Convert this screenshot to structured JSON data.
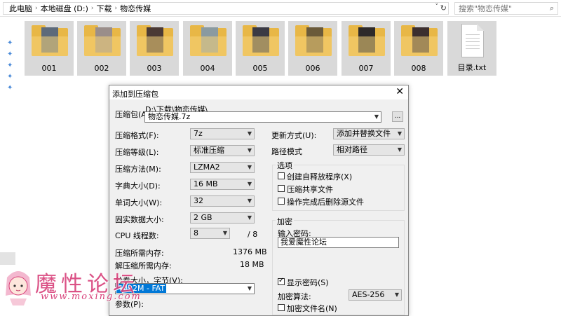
{
  "explorer": {
    "breadcrumbs": [
      "此电脑",
      "本地磁盘 (D:)",
      "下载",
      "物恋传媒"
    ],
    "search_placeholder": "搜索\"物恋传媒\"",
    "files": [
      {
        "label": "001",
        "type": "folder"
      },
      {
        "label": "002",
        "type": "folder"
      },
      {
        "label": "003",
        "type": "folder"
      },
      {
        "label": "004",
        "type": "folder"
      },
      {
        "label": "005",
        "type": "folder"
      },
      {
        "label": "006",
        "type": "folder"
      },
      {
        "label": "007",
        "type": "folder"
      },
      {
        "label": "008",
        "type": "folder"
      },
      {
        "label": "目录.txt",
        "type": "text-file"
      }
    ]
  },
  "dialog": {
    "title": "添加到压缩包",
    "archive_label": "压缩包(A)",
    "archive_dir": "D:\\下载\\物恋传媒\\",
    "archive_name": "物恋传媒.7z",
    "browse_label": "...",
    "left": {
      "format_label": "压缩格式(F):",
      "format_value": "7z",
      "level_label": "压缩等级(L):",
      "level_value": "标准压缩",
      "method_label": "压缩方法(M):",
      "method_value": "LZMA2",
      "dict_label": "字典大小(D):",
      "dict_value": "16 MB",
      "word_label": "单词大小(W):",
      "word_value": "32",
      "solid_label": "固实数据大小:",
      "solid_value": "2 GB",
      "cpu_label": "CPU 线程数:",
      "cpu_value": "8",
      "cpu_total": "/ 8",
      "mem_compress_label": "压缩所需内存:",
      "mem_compress_value": "1376 MB",
      "mem_decompress_label": "解压缩所需内存:",
      "mem_decompress_value": "18 MB",
      "volume_label": "分卷大小，字节(V):",
      "volume_value": "4092M - FAT",
      "params_label": "参数(P):"
    },
    "right": {
      "update_label": "更新方式(U):",
      "update_value": "添加并替换文件",
      "path_label": "路径模式",
      "path_value": "相对路径",
      "options_title": "选项",
      "opt_sfx": "创建自释放程序(X)",
      "opt_shared": "压缩共享文件",
      "opt_delete": "操作完成后删除源文件",
      "encrypt_title": "加密",
      "password_label": "输入密码:",
      "password_value": "我爱魔性论坛",
      "show_password": "显示密码(S)",
      "enc_method_label": "加密算法:",
      "enc_method_value": "AES-256",
      "enc_names": "加密文件名(N)"
    }
  },
  "watermark": {
    "title": "魔性论坛",
    "url": "www.moxing.com"
  },
  "colors": {
    "folder": "#e8b746",
    "folder_front": "#f6d37a",
    "selection": "#0078d7",
    "watermark": "#d8407a"
  }
}
